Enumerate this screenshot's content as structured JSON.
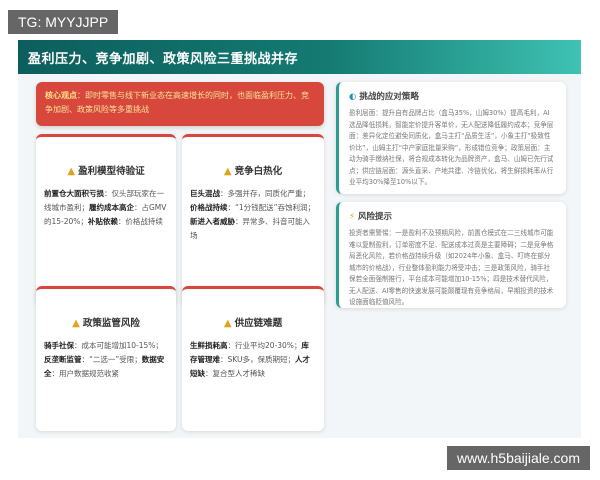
{
  "watermark_top": "TG: MYYJJPP",
  "watermark_bottom": "www.h5baijiale.com",
  "header": {
    "title": "盈利压力、竞争加剧、政策风险三重挑战并存"
  },
  "core": {
    "label": "核心观点",
    "text": "：即时零售与线下新业态在高速增长的同时，也面临盈利压力、竞争加剧、政策风险等多重挑战"
  },
  "cards": [
    {
      "title": "盈利模型待验证",
      "body": [
        {
          "bold": "前置仓大面积亏损",
          "text": "：仅头部玩家在一线城市盈利；"
        },
        {
          "bold": "履约成本高企",
          "text": "：占GMV的15-20%；"
        },
        {
          "bold": "补贴依赖",
          "text": "：价格战持续"
        }
      ]
    },
    {
      "title": "竞争白热化",
      "body": [
        {
          "bold": "巨头混战",
          "text": "：多强并存，同质化严重；"
        },
        {
          "bold": "价格战持续",
          "text": "：“1分钱配送”吞蚀利润；"
        },
        {
          "bold": "新进入者威胁",
          "text": "：异常多、抖音可能入场"
        }
      ]
    },
    {
      "title": "政策监管风险",
      "body": [
        {
          "bold": "骑手社保",
          "text": "：成本可能增加10-15%；"
        },
        {
          "bold": "反垄断监管",
          "text": "：“二选一”受限；"
        },
        {
          "bold": "数据安全",
          "text": "：用户数据规范收紧"
        }
      ]
    },
    {
      "title": "供应链难题",
      "body": [
        {
          "bold": "生鲜损耗高",
          "text": "：行业平均20-30%；"
        },
        {
          "bold": "库存管理难",
          "text": "：SKU多，保质期短；"
        },
        {
          "bold": "人才短缺",
          "text": "：复合型人才稀缺"
        }
      ]
    }
  ],
  "side": {
    "strategy": {
      "title": "挑战的应对策略",
      "text": "盈利层面：提升自有品牌占比（盒马35%，山姆30%）提高毛利，AI选品降低损耗，智能定价提升客单价，无人配送降低履约成本；竞争层面：差异化定位避免同质化，盒马主打“品质生活”，小象主打“极致性价比”，山姆主打“中产家庭批量采购”，形成错位竞争；政策层面：主动为骑手缴纳社保，将合规成本转化为品牌资产，盒马、山姆已先行试点；供应链层面：源头直采、产地共建、冷链优化，将生鲜损耗率从行业平均30%降至10%以下。"
    },
    "risk": {
      "title": "风险提示",
      "text": "投资者需警惕：一是盈利不及预期风险，前置仓模式在二三线城市可能难以复制盈利，订单密度不足、配送成本过高是主要障碍；二是竞争格局恶化风险，若价格战持续升级（如2024年小象、盒马、叮咚在部分城市的价格战），行业整体盈利能力将受冲击；三是政策风险，骑手社保若全面强制推行，平台成本可能增加10-15%；四是技术替代风险，无人配送、AI零售的快速发展可能颠覆现有竞争格局，早期投资的技术设施面临贬值风险。"
    }
  },
  "colors": {
    "header": "#147a72",
    "core_bg": "#d8473c",
    "accent": "#2e9c8f",
    "warn": "#e0a31b"
  },
  "icons": {
    "card_title": "warning-triangle-icon",
    "strategy": "shield-icon",
    "risk": "lightning-icon"
  }
}
